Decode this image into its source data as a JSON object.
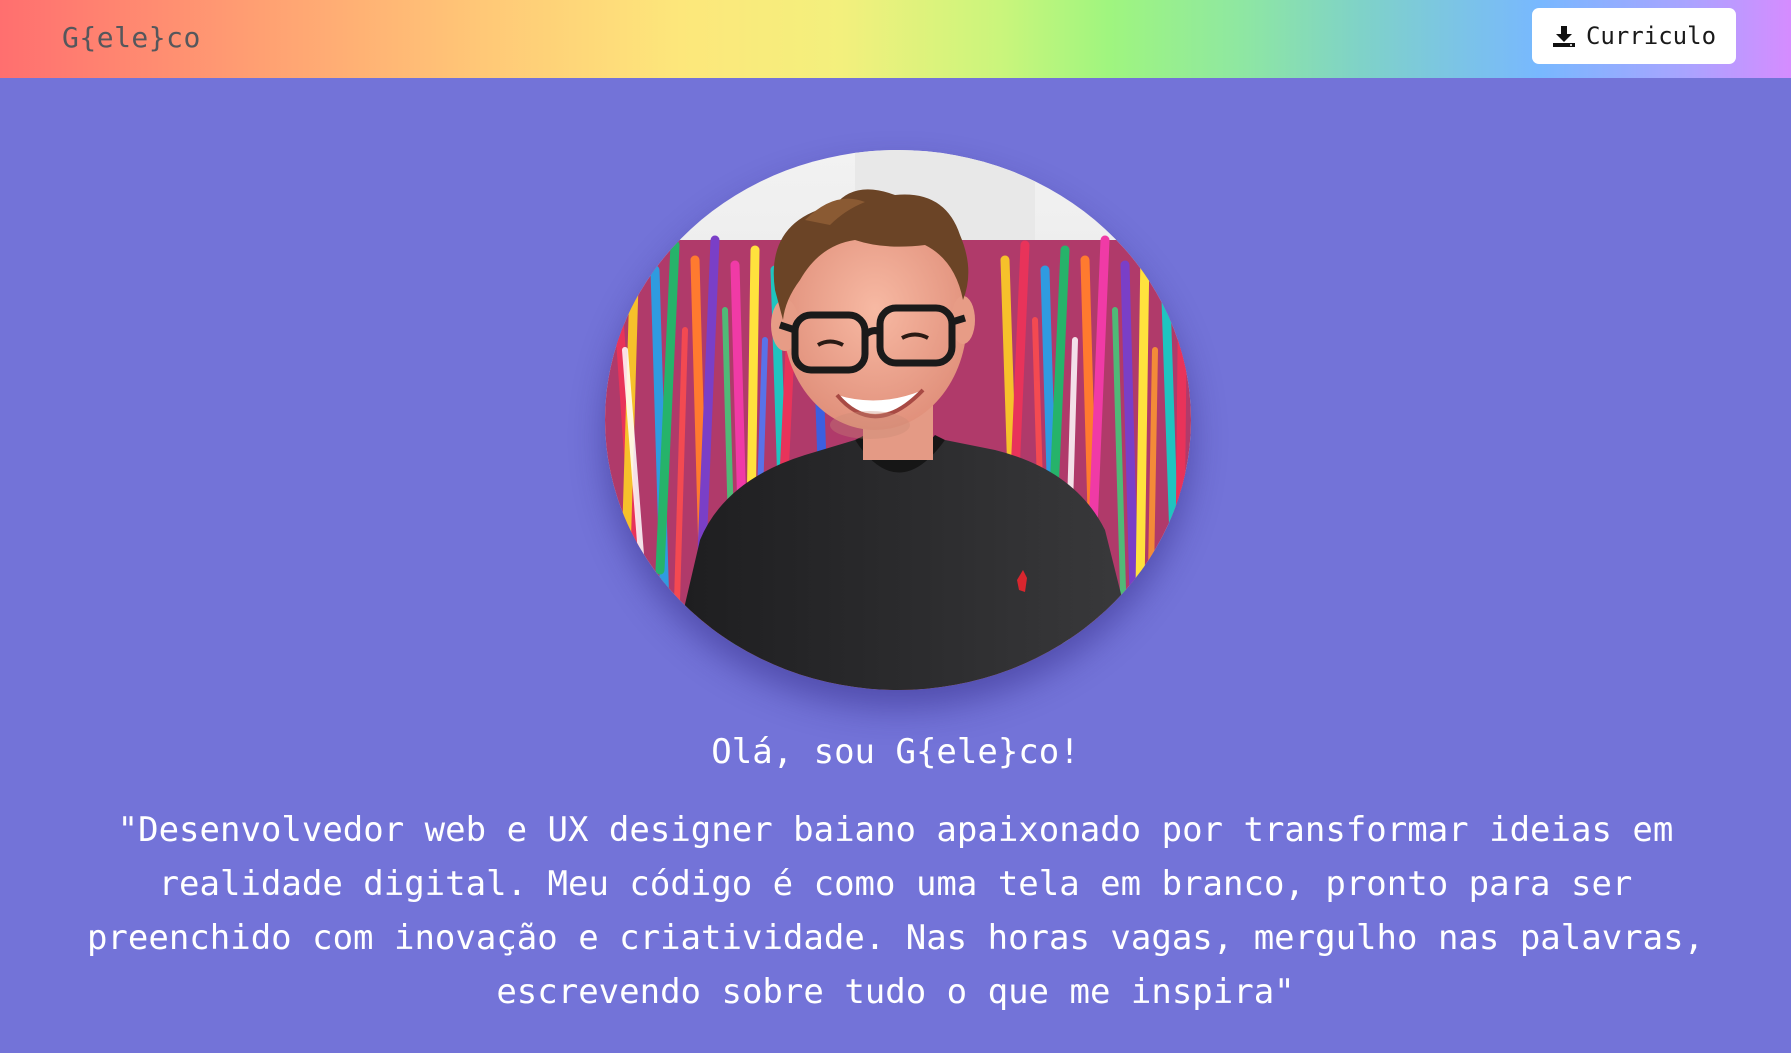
{
  "navbar": {
    "brand": "G{ele}co",
    "resume_button": {
      "icon": "download-icon",
      "label": "Curriculo"
    }
  },
  "hero": {
    "avatar": "profile-photo",
    "greeting": "Olá, sou G{ele}co!",
    "bio": "\"Desenvolvedor web e UX designer baiano apaixonado por transformar ideias em realidade digital. Meu código é como uma tela em branco, pronto para ser preenchido com inovação e criatividade. Nas horas vagas, mergulho nas palavras, escrevendo sobre tudo o que me inspira\""
  },
  "colors": {
    "background": "#7373d8",
    "text": "#ffffff",
    "brand_text": "#55575c",
    "button_bg": "#ffffff"
  }
}
